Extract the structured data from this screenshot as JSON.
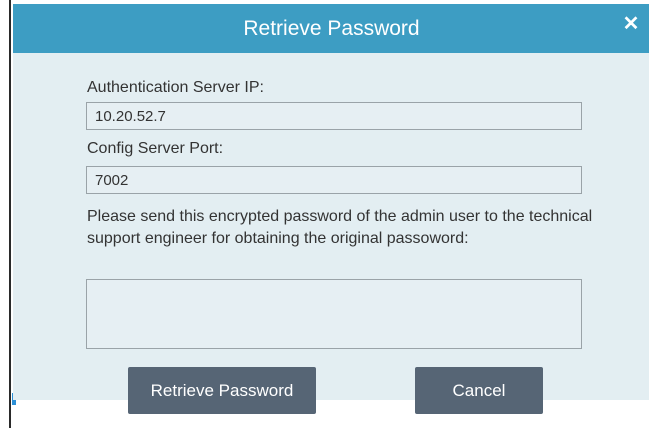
{
  "dialog": {
    "title": "Retrieve Password",
    "close_icon": "✕"
  },
  "form": {
    "auth_ip_label": "Authentication Server  IP:",
    "auth_ip_value": "10.20.52.7",
    "config_port_label": "Config Server Port:",
    "config_port_value": "7002",
    "note": "Please send this encrypted password of the admin user to the technical support engineer for obtaining the original passoword:",
    "encrypted_password_value": ""
  },
  "buttons": {
    "retrieve_label": "Retrieve Password",
    "cancel_label": "Cancel"
  },
  "colors": {
    "titlebar": "#3d9dc3",
    "body": "#e3eef2",
    "button": "#566575"
  }
}
